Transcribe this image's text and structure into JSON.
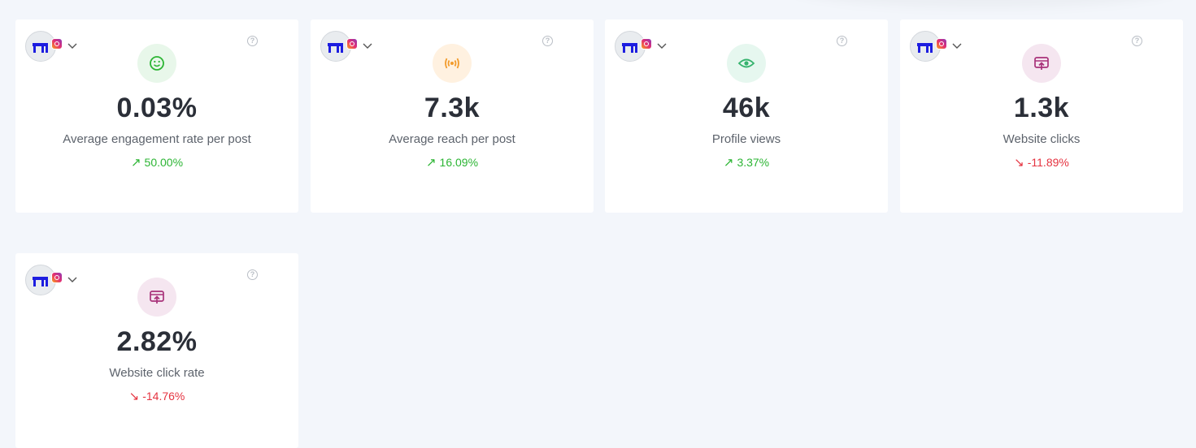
{
  "colors": {
    "up": "#2cb534",
    "down": "#e53340",
    "engagement_bg": "#e8f7ea",
    "engagement_fg": "#2cb534",
    "reach_bg": "#fff1e0",
    "reach_fg": "#f29b2b",
    "views_bg": "#e6f7ef",
    "views_fg": "#36b36e",
    "clicks_bg": "#f5e6f0",
    "clicks_fg": "#a8327a"
  },
  "cards": [
    {
      "value": "0.03%",
      "label": "Average engagement rate per post",
      "trend": "50.00%",
      "direction": "up",
      "icon": "smile-icon",
      "help": "?"
    },
    {
      "value": "7.3k",
      "label": "Average reach per post",
      "trend": "16.09%",
      "direction": "up",
      "icon": "broadcast-icon",
      "help": "?"
    },
    {
      "value": "46k",
      "label": "Profile views",
      "trend": "3.37%",
      "direction": "up",
      "icon": "eye-icon",
      "help": "?"
    },
    {
      "value": "1.3k",
      "label": "Website clicks",
      "trend": "-11.89%",
      "direction": "down",
      "icon": "website-click-icon",
      "help": "?"
    },
    {
      "value": "2.82%",
      "label": "Website click rate",
      "trend": "-14.76%",
      "direction": "down",
      "icon": "website-click-icon",
      "help": "?"
    }
  ],
  "arrows": {
    "up": "↗",
    "down": "↘"
  }
}
